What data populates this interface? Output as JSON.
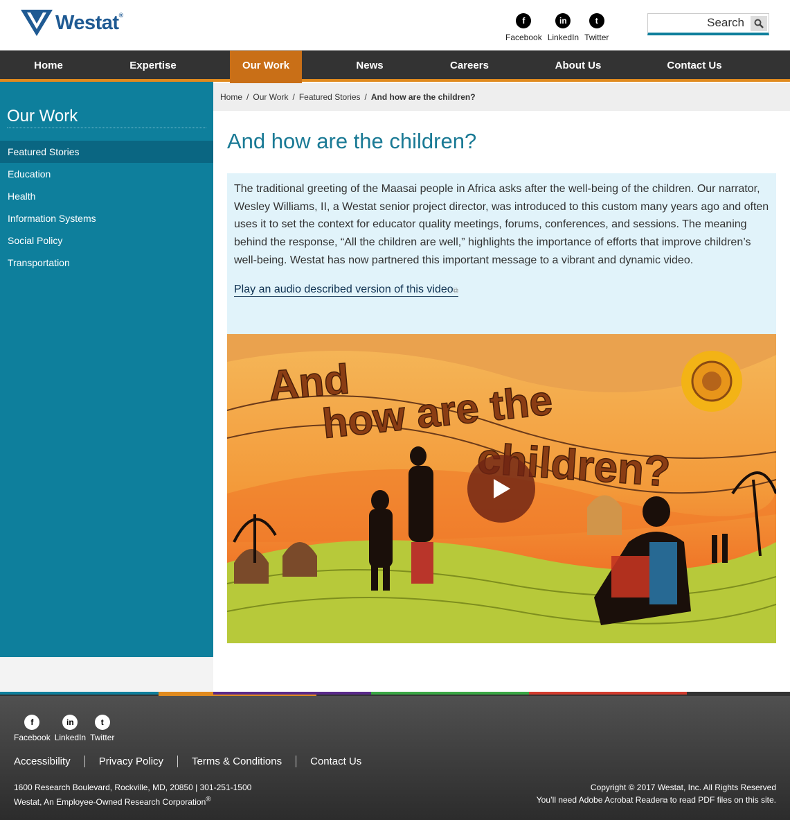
{
  "header": {
    "logo_text": "Westat",
    "logo_reg": "®",
    "social": [
      {
        "label": "Facebook",
        "icon": "facebook-icon",
        "glyph": "f"
      },
      {
        "label": "LinkedIn",
        "icon": "linkedin-icon",
        "glyph": "in"
      },
      {
        "label": "Twitter",
        "icon": "twitter-icon",
        "glyph": "t"
      }
    ],
    "search_placeholder": "Search"
  },
  "nav": {
    "items": [
      "Home",
      "Expertise",
      "Our Work",
      "News",
      "Careers",
      "About Us",
      "Contact Us"
    ],
    "active": "Our Work"
  },
  "sidebar": {
    "title": "Our Work",
    "items": [
      "Featured Stories",
      "Education",
      "Health",
      "Information Systems",
      "Social Policy",
      "Transportation"
    ],
    "active": "Featured Stories"
  },
  "breadcrumb": {
    "items": [
      "Home",
      "Our Work",
      "Featured Stories"
    ],
    "current": "And how are the children?",
    "separator": "/"
  },
  "main": {
    "title": "And how are the children?",
    "intro": "The traditional greeting of the Maasai people in Africa asks after the well-being of the children. Our narrator, Wesley Williams, II, a Westat senior project director, was introduced to this custom many years ago and often uses it to set the context for educator quality meetings, forums, conferences, and sessions. The meaning behind the response, “All the children are well,” highlights the importance of efforts that improve children’s well-being. Westat has now partnered this important message to a vibrant and dynamic video.",
    "audio_link": "Play an audio described version of this video",
    "video_title_lines": [
      "And",
      "how are the",
      "children?"
    ]
  },
  "footer": {
    "social": [
      {
        "label": "Facebook",
        "icon": "facebook-icon",
        "glyph": "f"
      },
      {
        "label": "LinkedIn",
        "icon": "linkedin-icon",
        "glyph": "in"
      },
      {
        "label": "Twitter",
        "icon": "twitter-icon",
        "glyph": "t"
      }
    ],
    "links": [
      "Accessibility",
      "Privacy Policy",
      "Terms & Conditions",
      "Contact Us"
    ],
    "address_line1": "1600 Research Boulevard, Rockville, MD, 20850  |  301-251-1500",
    "address_line2": "Westat, An Employee-Owned Research Corporation",
    "address_reg": "®",
    "copyright": "Copyright © 2017 Westat, Inc. All Rights Reserved",
    "acrobat_note_pre": "You’ll need Adobe Acrobat Reader",
    "acrobat_note_post": " to read PDF files on this site."
  },
  "colors": {
    "brand_blue": "#1f5a93",
    "teal": "#0e7f9c",
    "orange": "#c96f17",
    "nav_bg": "#333333",
    "intro_bg": "#e1f3fa",
    "stripe": [
      "#0e7f9c",
      "#e08a1e",
      "#5a2a8a",
      "#3aa845",
      "#d23c2e"
    ]
  }
}
